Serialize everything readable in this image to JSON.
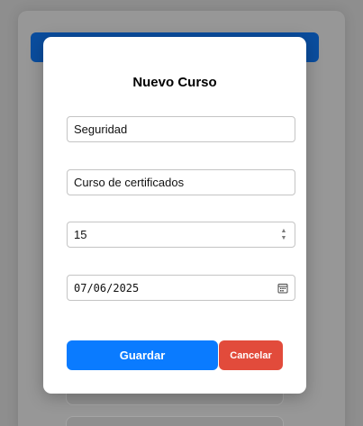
{
  "modal": {
    "title": "Nuevo Curso",
    "fields": {
      "name": "Seguridad",
      "description": "Curso de certificados",
      "number": "15",
      "date": "07/06/2025"
    },
    "icons": {
      "number_spinner": "spinner-icon",
      "date_picker": "calendar-icon"
    },
    "buttons": {
      "save": "Guardar",
      "cancel": "Cancelar"
    }
  },
  "colors": {
    "save_button": "#0a7bff",
    "cancel_button": "#e24b3b",
    "background_header": "#0a4d9e"
  }
}
